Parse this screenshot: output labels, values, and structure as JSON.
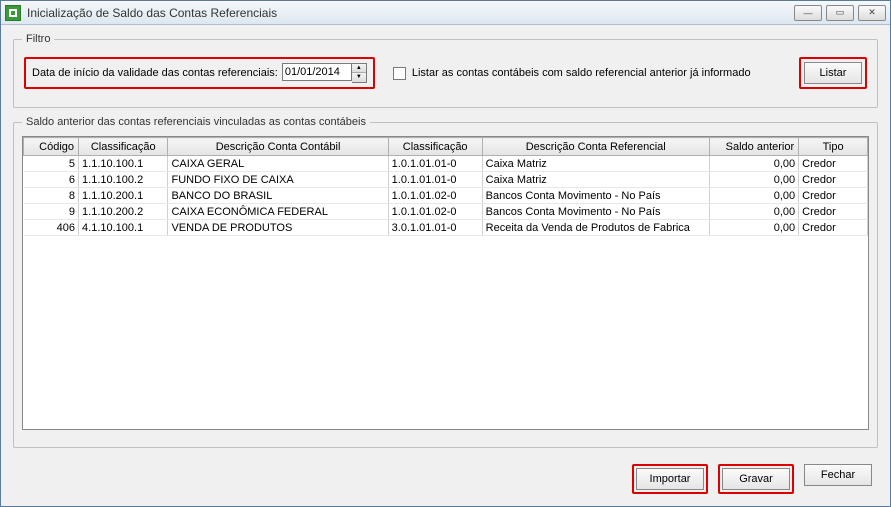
{
  "window": {
    "title": "Inicialização de Saldo das Contas Referenciais"
  },
  "filtro": {
    "legend": "Filtro",
    "date_label": "Data de início da validade das contas referenciais:",
    "date_value": "01/01/2014",
    "checkbox_label": "Listar as contas contábeis com saldo referencial anterior já informado",
    "listar_label": "Listar"
  },
  "grid": {
    "legend": "Saldo anterior das contas referenciais vinculadas as contas contábeis",
    "columns": [
      "Código",
      "Classificação",
      "Descrição Conta Contábil",
      "Classificação",
      "Descrição Conta Referencial",
      "Saldo anterior",
      "Tipo"
    ],
    "rows": [
      {
        "codigo": "5",
        "class1": "1.1.10.100.1",
        "desc1": "CAIXA GERAL",
        "class2": "1.0.1.01.01-0",
        "desc2": "Caixa Matriz",
        "saldo": "0,00",
        "tipo": "Credor"
      },
      {
        "codigo": "6",
        "class1": "1.1.10.100.2",
        "desc1": "FUNDO FIXO DE CAIXA",
        "class2": "1.0.1.01.01-0",
        "desc2": "Caixa Matriz",
        "saldo": "0,00",
        "tipo": "Credor"
      },
      {
        "codigo": "8",
        "class1": "1.1.10.200.1",
        "desc1": "BANCO DO BRASIL",
        "class2": "1.0.1.01.02-0",
        "desc2": "Bancos Conta Movimento - No País",
        "saldo": "0,00",
        "tipo": "Credor"
      },
      {
        "codigo": "9",
        "class1": "1.1.10.200.2",
        "desc1": "CAIXA ECONÔMICA FEDERAL",
        "class2": "1.0.1.01.02-0",
        "desc2": "Bancos Conta Movimento - No País",
        "saldo": "0,00",
        "tipo": "Credor"
      },
      {
        "codigo": "406",
        "class1": "4.1.10.100.1",
        "desc1": "VENDA DE PRODUTOS",
        "class2": "3.0.1.01.01-0",
        "desc2": "Receita da Venda de Produtos de Fabrica",
        "saldo": "0,00",
        "tipo": "Credor"
      }
    ]
  },
  "footer": {
    "importar": "Importar",
    "gravar": "Gravar",
    "fechar": "Fechar"
  }
}
